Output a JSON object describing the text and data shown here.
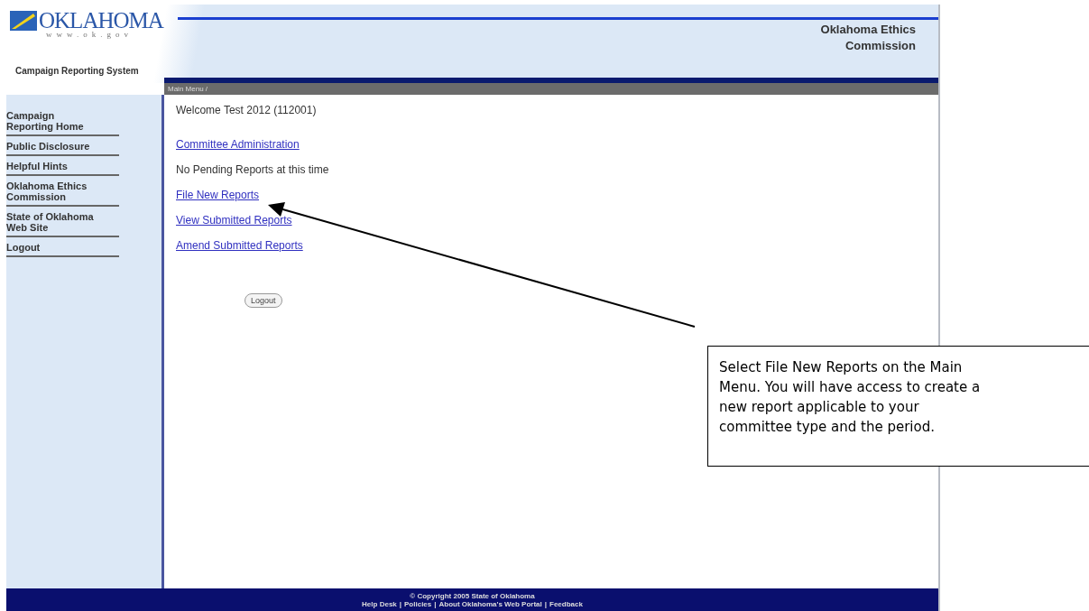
{
  "header": {
    "logo_title": "OKLAHOMA",
    "logo_url": "www.ok.gov",
    "system_name": "Campaign Reporting System",
    "agency": "Oklahoma Ethics Commission"
  },
  "breadcrumb": "Main Menu /",
  "sidebar": {
    "items": [
      {
        "label": "Campaign Reporting Home"
      },
      {
        "label": "Public Disclosure"
      },
      {
        "label": "Helpful Hints"
      },
      {
        "label": "Oklahoma Ethics Commission"
      },
      {
        "label": "State of Oklahoma Web Site"
      },
      {
        "label": "Logout"
      }
    ]
  },
  "content": {
    "welcome": "Welcome Test 2012 (112001)",
    "items": [
      {
        "kind": "link",
        "text": "Committee Administration"
      },
      {
        "kind": "text",
        "text": "No Pending Reports at this time"
      },
      {
        "kind": "link",
        "text": "File New Reports"
      },
      {
        "kind": "link",
        "text": "View Submitted Reports"
      },
      {
        "kind": "link",
        "text": "Amend Submitted Reports"
      }
    ],
    "button": "Logout"
  },
  "footer": {
    "copyright": "© Copyright 2005 State of Oklahoma",
    "links": [
      "Help Desk",
      "Policies",
      "About Oklahoma's Web Portal",
      "Feedback"
    ],
    "separator": "|"
  },
  "callout": {
    "text": "Select File New Reports on the Main Menu. You will have access to create a new report applicable to your committee type and the period."
  }
}
